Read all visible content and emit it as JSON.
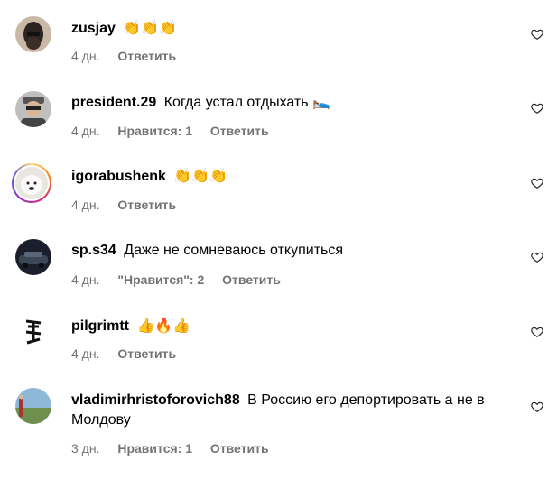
{
  "comments": [
    {
      "username": "zusjay",
      "text": "👏👏👏",
      "time": "4 дн.",
      "likes": "",
      "reply": "Ответить"
    },
    {
      "username": "president.29",
      "text": "Когда устал отдыхать 🛌",
      "time": "4 дн.",
      "likes": "Нравится: 1",
      "reply": "Ответить"
    },
    {
      "username": "igorabushenk",
      "text": "👏👏👏",
      "time": "4 дн.",
      "likes": "",
      "reply": "Ответить"
    },
    {
      "username": "sp.s34",
      "text": "Даже не сомневаюсь откупиться",
      "time": "4 дн.",
      "likes": "\"Нравится\": 2",
      "reply": "Ответить"
    },
    {
      "username": "pilgrimtt",
      "text": "👍🔥👍",
      "time": "4 дн.",
      "likes": "",
      "reply": "Ответить"
    },
    {
      "username": "vladimirhristoforovich88",
      "text": "В Россию его депортировать а не в Молдову",
      "time": "3 дн.",
      "likes": "Нравится: 1",
      "reply": "Ответить"
    }
  ],
  "colors": {
    "meta": "#737373",
    "text": "#000000",
    "heart": "#262626"
  }
}
